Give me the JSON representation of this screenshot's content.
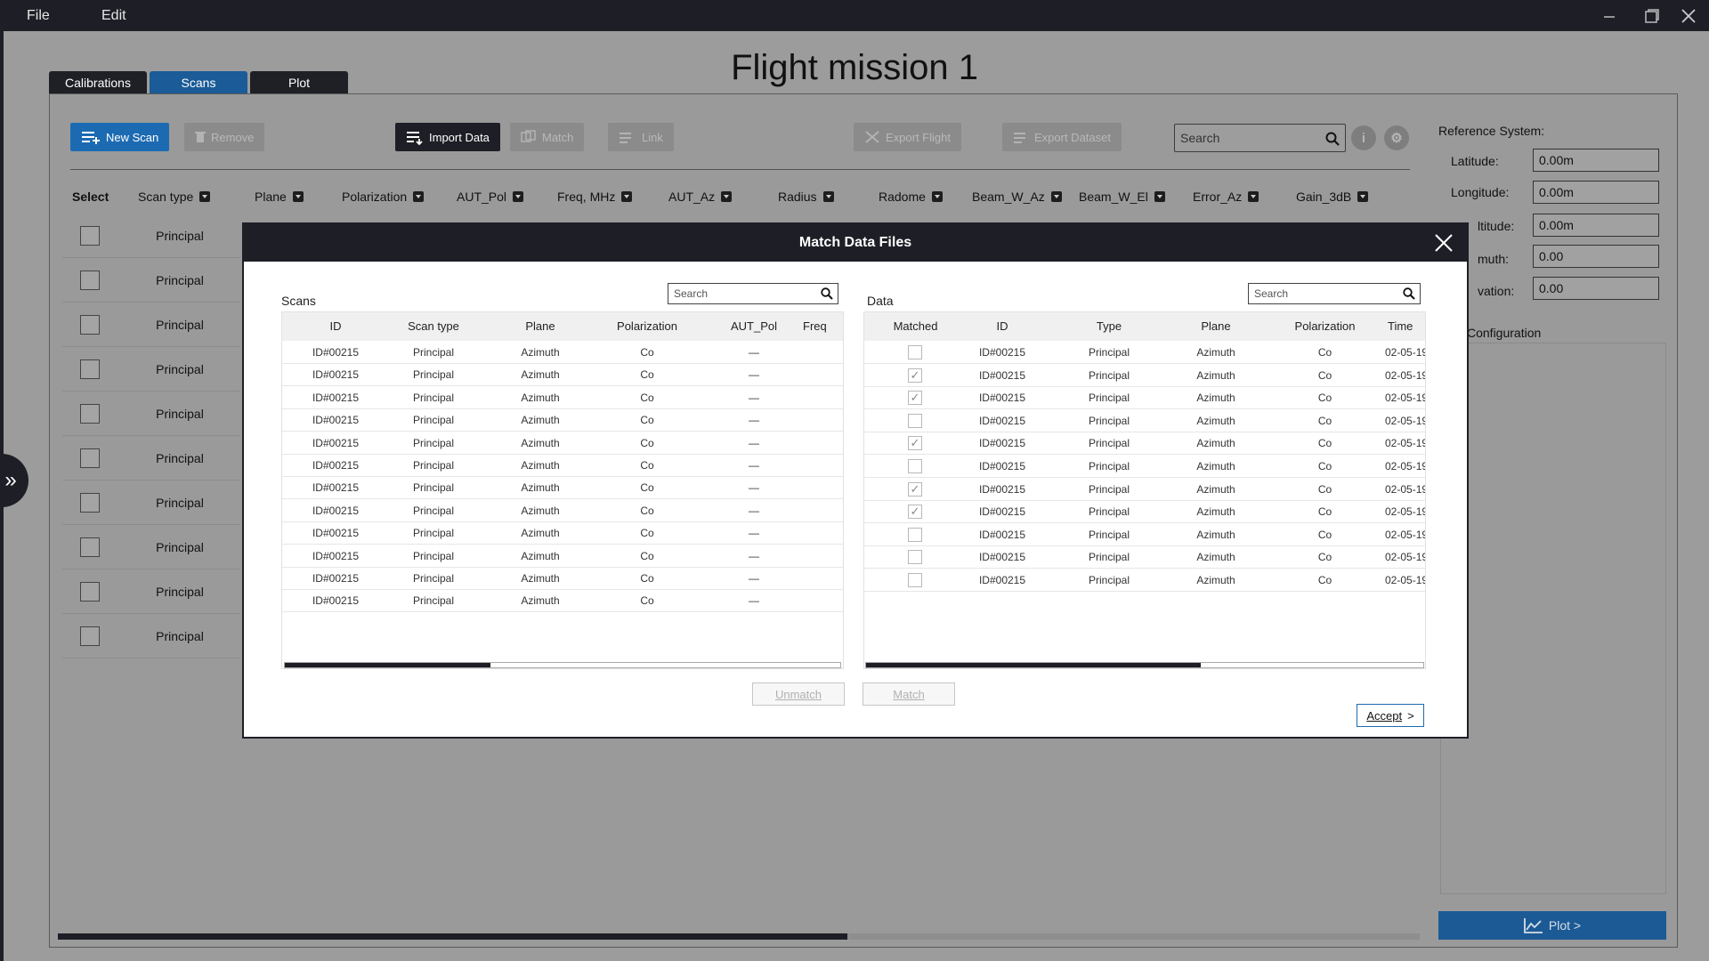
{
  "menu": {
    "file": "File",
    "edit": "Edit"
  },
  "page_title": "Flight mission 1",
  "tabs": [
    "Calibrations",
    "Scans",
    "Plot"
  ],
  "toolbar": {
    "new_scan": "New Scan",
    "remove": "Remove",
    "import_data": "Import Data",
    "match": "Match",
    "link": "Link",
    "export_flight": "Export Flight",
    "export_dataset": "Export Dataset",
    "search_placeholder": "Search"
  },
  "main_columns": [
    "Select",
    "Scan type",
    "Plane",
    "Polarization",
    "AUT_Pol",
    "Freq, MHz",
    "AUT_Az",
    "Radius",
    "Radome",
    "Beam_W_Az",
    "Beam_W_El",
    "Error_Az",
    "Gain_3dB"
  ],
  "main_rows": [
    "Principal",
    "Principal",
    "Principal",
    "Principal",
    "Principal",
    "Principal",
    "Principal",
    "Principal",
    "Principal",
    "Principal"
  ],
  "reference": {
    "title": "Reference System:",
    "fields": [
      {
        "label": "Latitude:",
        "value": "0.00m"
      },
      {
        "label": "Longitude:",
        "value": "0.00m"
      },
      {
        "label": "ltitude:",
        "value": "0.00m"
      },
      {
        "label": "muth:",
        "value": "0.00"
      },
      {
        "label": "vation:",
        "value": "0.00"
      }
    ],
    "config_label": "Configuration"
  },
  "plot_button": "Plot >",
  "modal": {
    "title": "Match Data Files",
    "scans_label": "Scans",
    "data_label": "Data",
    "search_placeholder": "Search",
    "scans_headers": [
      "ID",
      "Scan type",
      "Plane",
      "Polarization",
      "AUT_Pol",
      "Freq"
    ],
    "data_headers": [
      "Matched",
      "ID",
      "Type",
      "Plane",
      "Polarization",
      "Time"
    ],
    "scans_rows": [
      [
        "ID#00215",
        "Principal",
        "Azimuth",
        "Co",
        "—"
      ],
      [
        "ID#00215",
        "Principal",
        "Azimuth",
        "Co",
        "—"
      ],
      [
        "ID#00215",
        "Principal",
        "Azimuth",
        "Co",
        "—"
      ],
      [
        "ID#00215",
        "Principal",
        "Azimuth",
        "Co",
        "—"
      ],
      [
        "ID#00215",
        "Principal",
        "Azimuth",
        "Co",
        "—"
      ],
      [
        "ID#00215",
        "Principal",
        "Azimuth",
        "Co",
        "—"
      ],
      [
        "ID#00215",
        "Principal",
        "Azimuth",
        "Co",
        "—"
      ],
      [
        "ID#00215",
        "Principal",
        "Azimuth",
        "Co",
        "—"
      ],
      [
        "ID#00215",
        "Principal",
        "Azimuth",
        "Co",
        "—"
      ],
      [
        "ID#00215",
        "Principal",
        "Azimuth",
        "Co",
        "—"
      ],
      [
        "ID#00215",
        "Principal",
        "Azimuth",
        "Co",
        "—"
      ],
      [
        "ID#00215",
        "Principal",
        "Azimuth",
        "Co",
        "—"
      ]
    ],
    "data_rows": [
      {
        "matched": false,
        "id": "ID#00215",
        "type": "Principal",
        "plane": "Azimuth",
        "pol": "Co",
        "time": "02-05-19"
      },
      {
        "matched": true,
        "id": "ID#00215",
        "type": "Principal",
        "plane": "Azimuth",
        "pol": "Co",
        "time": "02-05-19"
      },
      {
        "matched": true,
        "id": "ID#00215",
        "type": "Principal",
        "plane": "Azimuth",
        "pol": "Co",
        "time": "02-05-19"
      },
      {
        "matched": false,
        "id": "ID#00215",
        "type": "Principal",
        "plane": "Azimuth",
        "pol": "Co",
        "time": "02-05-19"
      },
      {
        "matched": true,
        "id": "ID#00215",
        "type": "Principal",
        "plane": "Azimuth",
        "pol": "Co",
        "time": "02-05-19"
      },
      {
        "matched": false,
        "id": "ID#00215",
        "type": "Principal",
        "plane": "Azimuth",
        "pol": "Co",
        "time": "02-05-19"
      },
      {
        "matched": true,
        "id": "ID#00215",
        "type": "Principal",
        "plane": "Azimuth",
        "pol": "Co",
        "time": "02-05-19"
      },
      {
        "matched": true,
        "id": "ID#00215",
        "type": "Principal",
        "plane": "Azimuth",
        "pol": "Co",
        "time": "02-05-19"
      },
      {
        "matched": false,
        "id": "ID#00215",
        "type": "Principal",
        "plane": "Azimuth",
        "pol": "Co",
        "time": "02-05-19"
      },
      {
        "matched": false,
        "id": "ID#00215",
        "type": "Principal",
        "plane": "Azimuth",
        "pol": "Co",
        "time": "02-05-19"
      },
      {
        "matched": false,
        "id": "ID#00215",
        "type": "Principal",
        "plane": "Azimuth",
        "pol": "Co",
        "time": "02-05-19"
      }
    ],
    "unmatch": "Unmatch",
    "match": "Match",
    "accept": "Accept",
    "accept_arrow": ">"
  },
  "colors": {
    "accent": "#1c6bb2",
    "dark": "#1e1f26"
  }
}
